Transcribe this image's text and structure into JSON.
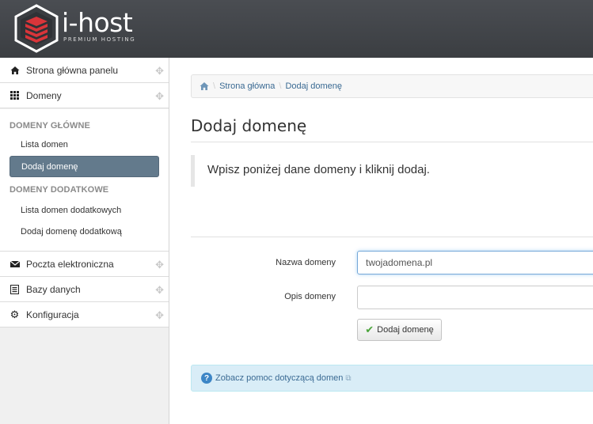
{
  "brand": {
    "name": "i-host",
    "tagline": "PREMIUM HOSTING",
    "accent": "#d9353a"
  },
  "sidebar": {
    "top_items": [
      {
        "label": "Strona główna panelu",
        "icon": "home-icon"
      },
      {
        "label": "Domeny",
        "icon": "grid-icon"
      }
    ],
    "sections": [
      {
        "title": "DOMENY GŁÓWNE",
        "items": [
          "Lista domen",
          "Dodaj domenę"
        ]
      },
      {
        "title": "DOMENY DODATKOWE",
        "items": [
          "Lista domen dodatkowych",
          "Dodaj domenę dodatkową"
        ]
      }
    ],
    "active_item": "Dodaj domenę",
    "bottom_items": [
      {
        "label": "Poczta elektroniczna",
        "icon": "envelope-icon"
      },
      {
        "label": "Bazy danych",
        "icon": "list-icon"
      },
      {
        "label": "Konfiguracja",
        "icon": "gear-icon"
      }
    ]
  },
  "breadcrumb": [
    "Strona główna",
    "Dodaj domenę"
  ],
  "page": {
    "title": "Dodaj domenę",
    "lead": "Wpisz poniżej dane domeny i kliknij dodaj."
  },
  "form": {
    "domain_label": "Nazwa domeny",
    "domain_value": "twojadomena.pl",
    "desc_label": "Opis domeny",
    "desc_value": "",
    "submit_label": "Dodaj domenę"
  },
  "help": {
    "link_text": "Zobacz pomoc dotyczącą domen"
  }
}
